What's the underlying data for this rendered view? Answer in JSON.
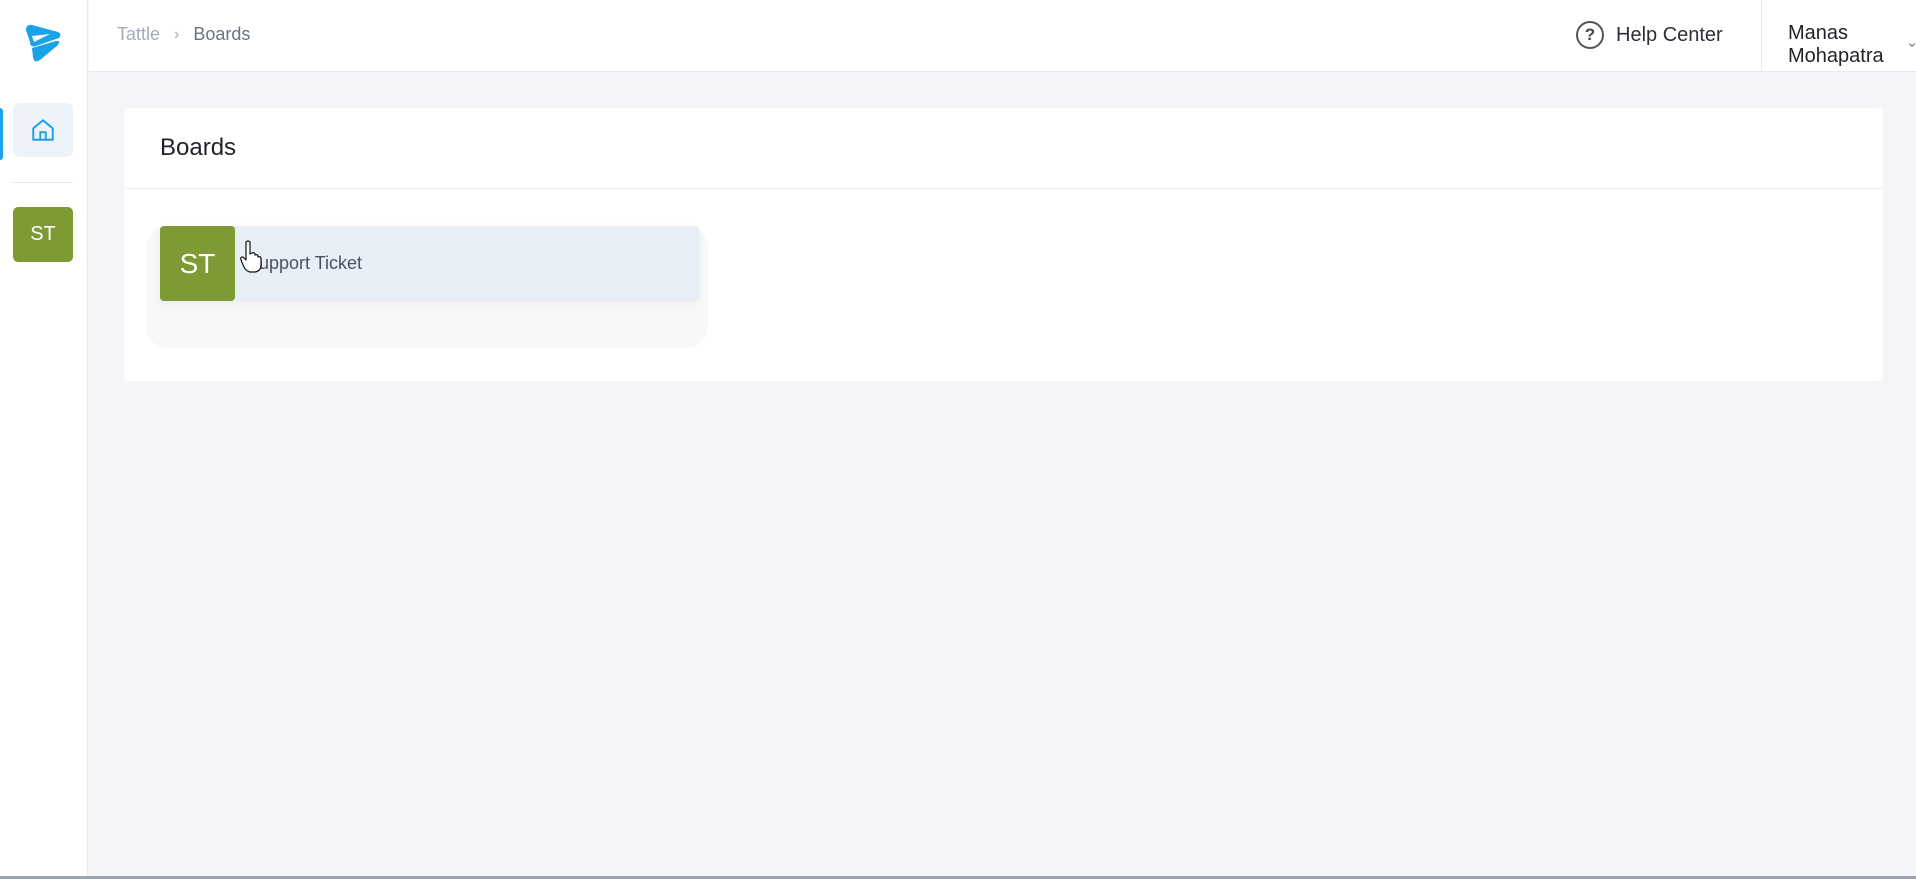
{
  "colors": {
    "brand": "#1aa2e8",
    "board_avatar": "#7e9a35",
    "background": "#f3f5f9",
    "board_item": "#e7eef6"
  },
  "sidebar": {
    "logo_icon": "tattle-logo-icon",
    "home_icon": "home-icon",
    "board_shortcut": "ST"
  },
  "breadcrumb": {
    "root": "Tattle",
    "separator_icon": "chevron-right-icon",
    "current": "Boards"
  },
  "header": {
    "help_icon": "question-circle-icon",
    "help_label": "Help Center",
    "user_name": "Manas Mohapatra",
    "user_menu_icon": "chevron-down-icon"
  },
  "main": {
    "title": "Boards",
    "boards": [
      {
        "initials": "ST",
        "name": "Support Ticket"
      }
    ]
  }
}
